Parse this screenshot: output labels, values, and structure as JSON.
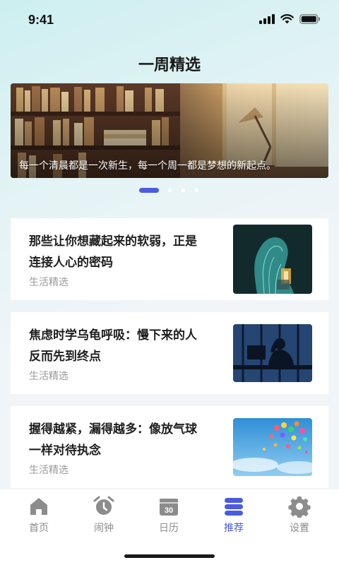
{
  "status_bar": {
    "time": "9:41"
  },
  "header": {
    "title": "一周精选"
  },
  "banner": {
    "caption": "每一个清晨都是一次新生，每一个周一都是梦想的新起点。",
    "pages": 4,
    "active_page": 1
  },
  "articles": [
    {
      "title": "那些让你想藏起来的软弱，正是连接人心的密码",
      "tag": "生活精选",
      "image": "woman-silhouette-illustration"
    },
    {
      "title": "焦虑时学乌龟呼吸：慢下来的人反而先到终点",
      "tag": "生活精选",
      "image": "man-at-desk-window"
    },
    {
      "title": "握得越紧，漏得越多：像放气球一样对待执念",
      "tag": "生活精选",
      "image": "balloons-in-sky"
    }
  ],
  "tabbar": {
    "items": [
      {
        "label": "首页",
        "icon": "home-icon"
      },
      {
        "label": "闹钟",
        "icon": "alarm-clock-icon"
      },
      {
        "label": "日历",
        "icon": "calendar-icon"
      },
      {
        "label": "推荐",
        "icon": "recommend-icon"
      },
      {
        "label": "设置",
        "icon": "gear-icon"
      }
    ],
    "active": "推荐"
  },
  "colors": {
    "accent": "#4b5be0",
    "tab_inactive": "#8c8c8c",
    "tag": "#9a9a9a"
  }
}
